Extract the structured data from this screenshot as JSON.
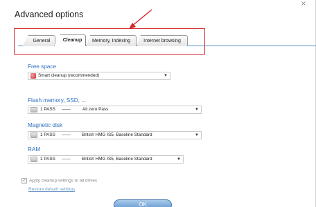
{
  "window": {
    "title": "Advanced options",
    "close_glyph": "×"
  },
  "tabs": [
    {
      "label": "General"
    },
    {
      "label": "Cleanup",
      "active": true
    },
    {
      "label": "Memory, Indexing"
    },
    {
      "label": "Internet browsing"
    }
  ],
  "sections": {
    "free_space": {
      "label": "Free space",
      "value": "Smart cleanup (recommended)",
      "icon": "red-cleanup-icon"
    },
    "flash": {
      "label": "Flash memory, SSD, ...",
      "passes": "1 PASS",
      "dash": "——",
      "method": "All zero Pass",
      "icon": "disk-icon"
    },
    "magnetic": {
      "label": "Magnetic disk",
      "passes": "1 PASS",
      "dash": "——",
      "method": "British HMG IS5, Baseline Standard",
      "icon": "disk-icon"
    },
    "ram": {
      "label": "RAM",
      "passes": "1 PASS",
      "dash": "——",
      "method": "British HMG IS5, Baseline Standard",
      "icon": "disk-icon"
    }
  },
  "apply_all": {
    "label": "Apply cleanup settings to all drives",
    "checked": true
  },
  "restore_link": "Restore default settings",
  "ok_label": "OK",
  "annotation": {
    "color": "#d2232a"
  }
}
